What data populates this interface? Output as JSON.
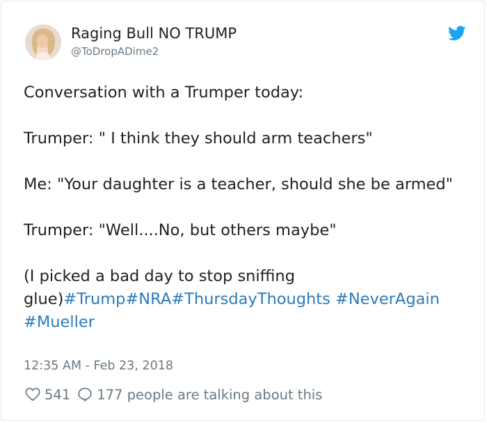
{
  "user": {
    "display_name": "Raging Bull NO TRUMP",
    "handle": "@ToDropADime2",
    "avatar_icon": "profile-photo"
  },
  "brand": {
    "icon": "twitter-bird-icon",
    "color": "#1da1f2"
  },
  "tweet": {
    "line1": "Conversation with a Trumper today:",
    "line2": "Trumper: \" I think they should arm teachers\"",
    "line3": "Me: \"Your daughter is a teacher, should she be armed\"",
    "line4": "Trumper: \"Well....No, but others maybe\"",
    "line5_text": "(I picked a bad day to stop sniffing glue)",
    "hashtags": [
      "#Trump",
      "#NRA",
      "#ThursdayThoughts",
      "#NeverAgain",
      "#Mueller"
    ],
    "hashtag_color": "#2b7bb9"
  },
  "timestamp": "12:35 AM - Feb 23, 2018",
  "stats": {
    "like_icon": "heart-icon",
    "likes": "541",
    "reply_icon": "speech-bubble-icon",
    "talking_text": "177 people are talking about this"
  },
  "colors": {
    "text": "#1c2022",
    "muted": "#697882",
    "border": "#e1e8ed"
  }
}
